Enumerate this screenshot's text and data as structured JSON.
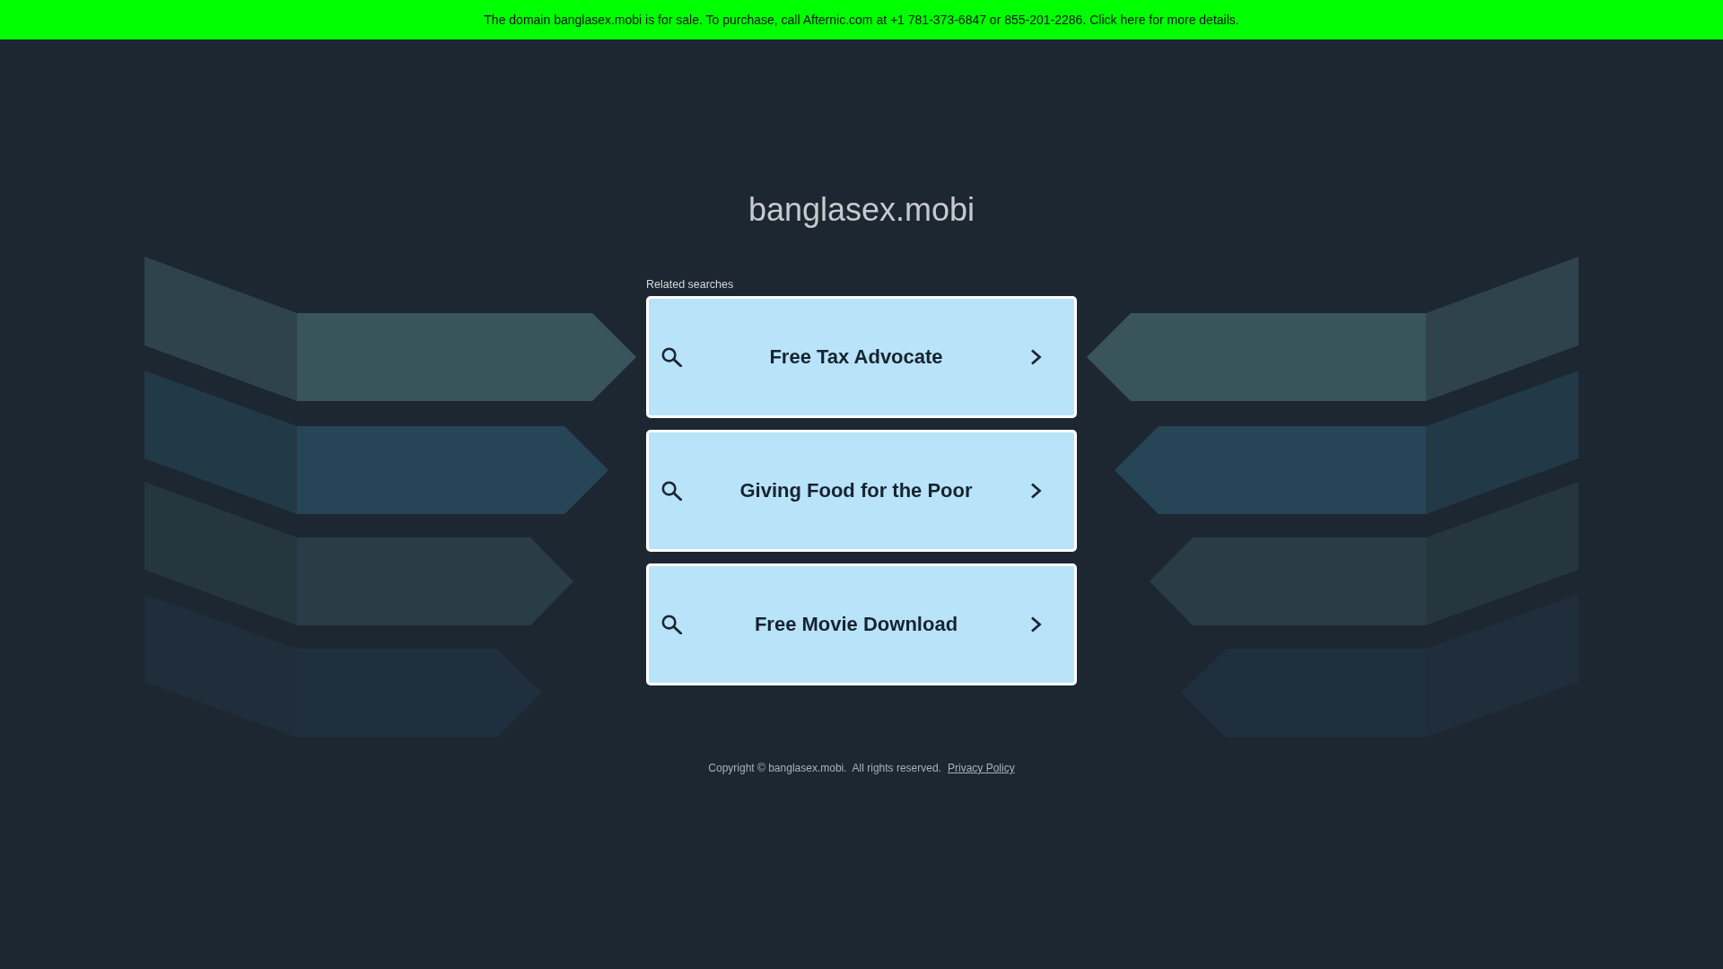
{
  "sale_banner": {
    "text": "The domain banglasex.mobi is for sale. To purchase, call Afternic.com at +1 781-373-6847 or 855-201-2286. Click here for more details."
  },
  "domain_title": "banglasex.mobi",
  "related_searches": {
    "label": "Related searches",
    "items": [
      {
        "text": "Free Tax Advocate"
      },
      {
        "text": "Giving Food for the Poor"
      },
      {
        "text": "Free Movie Download"
      }
    ]
  },
  "footer": {
    "copyright": "Copyright © banglasex.mobi.  All rights reserved.",
    "privacy_link": "Privacy Policy"
  }
}
